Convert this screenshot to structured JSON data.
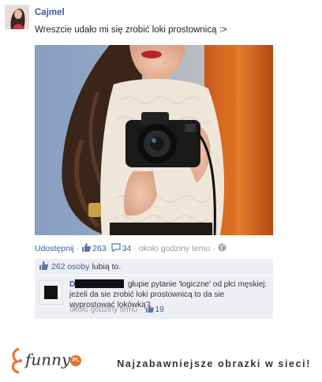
{
  "post": {
    "author": "Cajmel",
    "status_text": "Wreszcie udało mi się zrobić loki prostownicą :>"
  },
  "actions": {
    "share_label": "Udostępnij",
    "like_count": "263",
    "comment_count": "34",
    "time": "około godziny temu",
    "separator": "·"
  },
  "likes_box": {
    "count": "262 osoby",
    "text": "lubią to."
  },
  "comment": {
    "author_initial": "D",
    "text": "głupie pytanie 'logiczne' od płci męskiej: jeżeli da sie zrobić loki prostownicą to da sie wyprostować lokówką?",
    "time": "około godziny temu",
    "like_count": "19"
  },
  "footer": {
    "logo_text": "funny",
    "logo_badge": "PL",
    "tagline": "Najzabawniejsze obrazki w sieci!"
  },
  "colors": {
    "link": "#3b5998",
    "meta": "#999999",
    "box_bg": "#edeff4"
  }
}
